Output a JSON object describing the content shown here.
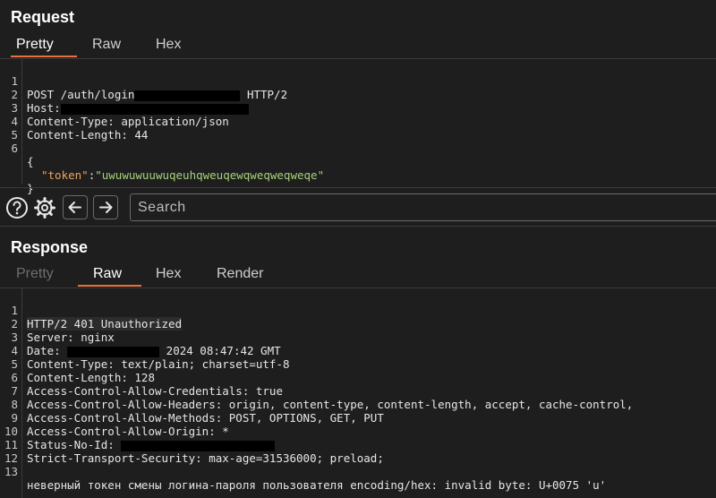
{
  "request": {
    "title": "Request",
    "tabs": [
      {
        "label": "Pretty",
        "state": "active"
      },
      {
        "label": "Raw",
        "state": "normal"
      },
      {
        "label": "Hex",
        "state": "normal"
      }
    ],
    "lines": [
      {
        "num": "1",
        "parts": [
          "POST /auth/login",
          "",
          " HTTP/2"
        ]
      },
      {
        "num": "2",
        "parts": [
          "Host:",
          ""
        ]
      },
      {
        "num": "3",
        "text": "Content-Type: application/json"
      },
      {
        "num": "4",
        "text": "Content-Length: 44"
      },
      {
        "num": "5",
        "text": ""
      },
      {
        "num": "6",
        "text": "{"
      },
      {
        "num": "",
        "key": "\"token\"",
        "sep": ":",
        "value": "\"uwuwuwuuwuqeuhqweuqewqweqweqweqe\""
      },
      {
        "num": "",
        "text": "}"
      }
    ]
  },
  "toolbar": {
    "help_icon": "question-circle-icon",
    "settings_icon": "gear-icon",
    "back_icon": "arrow-left-icon",
    "forward_icon": "arrow-right-icon",
    "search_placeholder": "Search"
  },
  "response": {
    "title": "Response",
    "tabs": [
      {
        "label": "Pretty",
        "state": "muted"
      },
      {
        "label": "Raw",
        "state": "active"
      },
      {
        "label": "Hex",
        "state": "normal"
      },
      {
        "label": "Render",
        "state": "normal"
      }
    ],
    "lines": [
      {
        "num": "1",
        "text": "HTTP/2 401 Unauthorized"
      },
      {
        "num": "2",
        "text": "Server: nginx"
      },
      {
        "num": "3",
        "parts": [
          "Date: ",
          "",
          " 2024 08:47:42 GMT"
        ]
      },
      {
        "num": "4",
        "text": "Content-Type: text/plain; charset=utf-8"
      },
      {
        "num": "5",
        "text": "Content-Length: 128"
      },
      {
        "num": "6",
        "text": "Access-Control-Allow-Credentials: true"
      },
      {
        "num": "7",
        "text": "Access-Control-Allow-Headers: origin, content-type, content-length, accept, cache-control,"
      },
      {
        "num": "8",
        "text": "Access-Control-Allow-Methods: POST, OPTIONS, GET, PUT"
      },
      {
        "num": "9",
        "text": "Access-Control-Allow-Origin: *"
      },
      {
        "num": "10",
        "parts": [
          "Status-No-Id: ",
          ""
        ]
      },
      {
        "num": "11",
        "text": "Strict-Transport-Security: max-age=31536000; preload;"
      },
      {
        "num": "12",
        "text": ""
      },
      {
        "num": "13",
        "text": "неверный токен смены логина-пароля пользователя encoding/hex: invalid byte: U+0075 'u'"
      }
    ]
  },
  "colors": {
    "accent": "#e8713b",
    "background": "#1e1e1e",
    "json_key": "#f0a35e",
    "json_string": "#a7d37a"
  }
}
